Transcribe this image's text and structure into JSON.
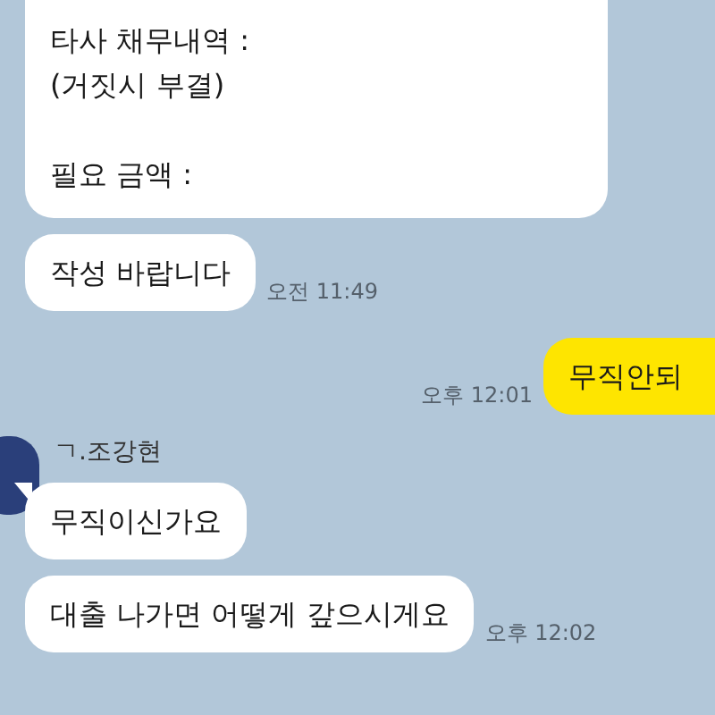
{
  "messages": [
    {
      "kind": "received",
      "text": "타사 채무내역 :\n(거짓시 부결)\n\n필요 금액 :",
      "clipped_top": true
    },
    {
      "kind": "received",
      "text": "작성 바랍니다",
      "time": "오전 11:49"
    },
    {
      "kind": "sent",
      "text": "무직안되",
      "time": "오후 12:01"
    },
    {
      "kind": "received",
      "sender": "ㄱ.조강현",
      "text": "무직이신가요",
      "tail": true
    },
    {
      "kind": "received",
      "text": "대출 나가면 어떻게 갚으시게요",
      "time": "오후 12:02"
    }
  ]
}
